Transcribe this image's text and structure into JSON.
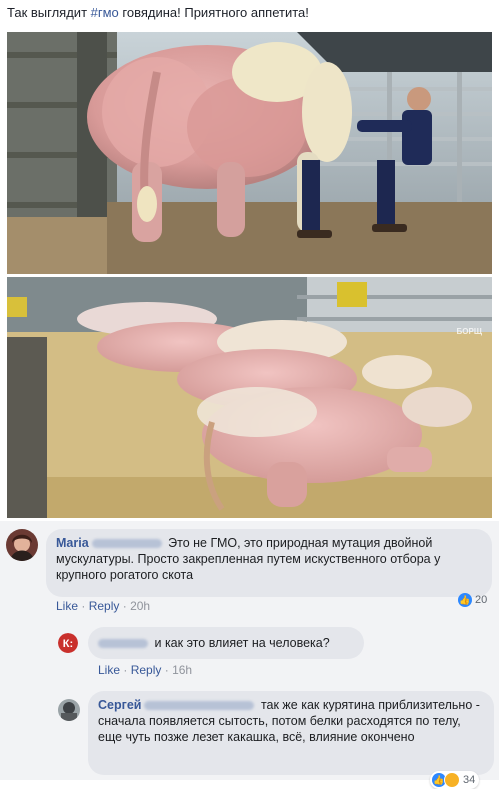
{
  "post": {
    "text_before": "Так выглядит ",
    "hashtag": "#гмо",
    "text_after": " говядина! Приятного аппетита!"
  },
  "photos": {
    "top_label": "photo of muscular cattle with farmer",
    "bottom_watermark": "БОРЩ"
  },
  "comments": [
    {
      "author_first": "Maria",
      "text": "Это не ГМО, это природная мутация двойной мускулатуры. Просто закрепленная путем искуственного отбора у крупного рогатого скота",
      "like": "Like",
      "reply": "Reply",
      "time": "20h",
      "reactions": "20"
    },
    {
      "avatar_letter": "K",
      "text": "и как это влияет на человека?",
      "like": "Like",
      "reply": "Reply",
      "time": "16h"
    },
    {
      "author_first": "Сергей",
      "text_line1": "так же как курятина",
      "text_rest": "приблизительно - сначала появляется сытость, потом белки расходятся по телу, еще чуть позже лезет какашка, всё, влияние окончено",
      "reactions": "34"
    }
  ],
  "colors": {
    "link": "#385898",
    "bubble": "#e4e6eb",
    "comments_bg": "#f2f3f5",
    "like_blue": "#2d88ff"
  }
}
